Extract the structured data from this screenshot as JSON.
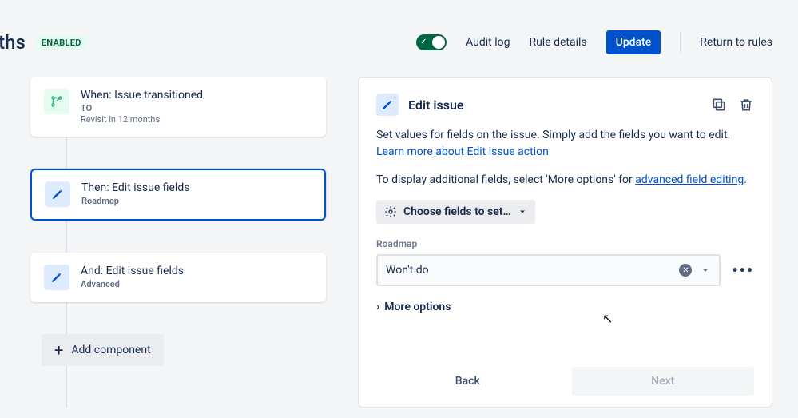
{
  "header": {
    "title_fragment": "iths",
    "status_badge": "ENABLED",
    "audit_log": "Audit log",
    "rule_details": "Rule details",
    "update": "Update",
    "return": "Return to rules"
  },
  "chain": {
    "trigger": {
      "title": "When: Issue transitioned",
      "sub1": "TO",
      "sub2": "Revisit in 12 months"
    },
    "action1": {
      "title": "Then: Edit issue fields",
      "sub1": "Roadmap"
    },
    "action2": {
      "title": "And: Edit issue fields",
      "sub1": "Advanced"
    },
    "add_component": "Add component"
  },
  "panel": {
    "title": "Edit issue",
    "desc1": "Set values for fields on the issue. Simply add the fields you want to edit. ",
    "desc1_link": "Learn more about Edit issue action",
    "desc2a": "To display additional fields, select 'More options' for ",
    "desc2_link": "advanced field editing",
    "desc2b": ".",
    "choose_fields": "Choose fields to set…",
    "field": {
      "label": "Roadmap",
      "value": "Won't do"
    },
    "more_options": "More options",
    "back": "Back",
    "next": "Next"
  }
}
